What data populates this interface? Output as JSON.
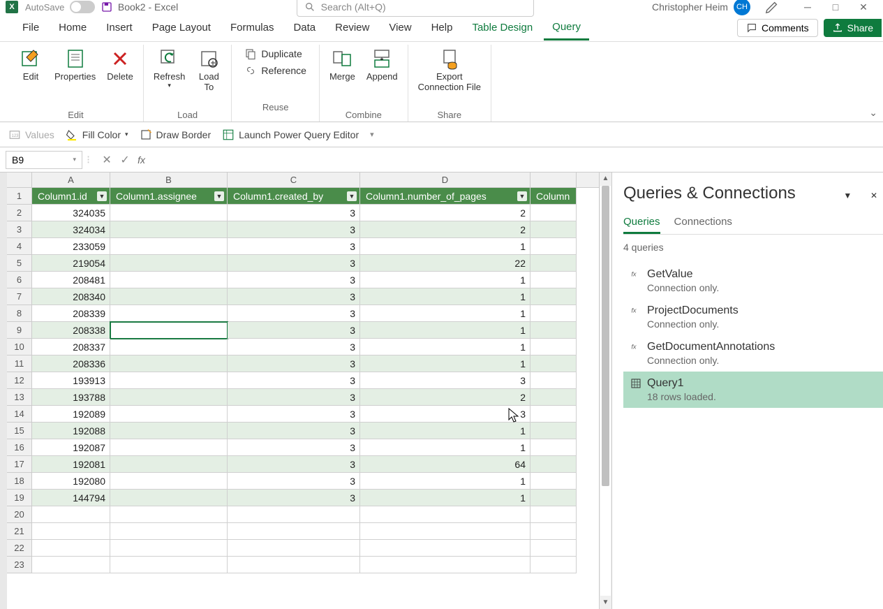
{
  "titlebar": {
    "autosave": "AutoSave",
    "autosave_state": "Off",
    "doc": "Book2  -  Excel",
    "search_placeholder": "Search (Alt+Q)",
    "user": "Christopher Heim",
    "initials": "CH"
  },
  "tabs": {
    "file": "File",
    "home": "Home",
    "insert": "Insert",
    "pagelayout": "Page Layout",
    "formulas": "Formulas",
    "data": "Data",
    "review": "Review",
    "view": "View",
    "help": "Help",
    "tabledesign": "Table Design",
    "query": "Query",
    "comments": "Comments",
    "share": "Share"
  },
  "ribbon": {
    "edit": "Edit",
    "properties": "Properties",
    "delete": "Delete",
    "refresh": "Refresh",
    "loadto": "Load\nTo",
    "duplicate": "Duplicate",
    "reference": "Reference",
    "merge": "Merge",
    "append": "Append",
    "export": "Export\nConnection File",
    "groups": {
      "edit": "Edit",
      "load": "Load",
      "reuse": "Reuse",
      "combine": "Combine",
      "share": "Share"
    }
  },
  "qtoolbar": {
    "values": "Values",
    "fillcolor": "Fill Color",
    "drawborder": "Draw Border",
    "launch": "Launch Power Query Editor"
  },
  "namebox": "B9",
  "columns": {
    "A": "A",
    "B": "B",
    "C": "C",
    "D": "D",
    "h1": "Column1.id",
    "h2": "Column1.assignee",
    "h3": "Column1.created_by",
    "h4": "Column1.number_of_pages",
    "h5": "Column"
  },
  "data_rows": [
    {
      "r": "1"
    },
    {
      "r": "2",
      "A": "324035",
      "C": "3",
      "D": "2"
    },
    {
      "r": "3",
      "A": "324034",
      "C": "3",
      "D": "2"
    },
    {
      "r": "4",
      "A": "233059",
      "C": "3",
      "D": "1"
    },
    {
      "r": "5",
      "A": "219054",
      "C": "3",
      "D": "22"
    },
    {
      "r": "6",
      "A": "208481",
      "C": "3",
      "D": "1"
    },
    {
      "r": "7",
      "A": "208340",
      "C": "3",
      "D": "1"
    },
    {
      "r": "8",
      "A": "208339",
      "C": "3",
      "D": "1"
    },
    {
      "r": "9",
      "A": "208338",
      "C": "3",
      "D": "1",
      "selB": true
    },
    {
      "r": "10",
      "A": "208337",
      "C": "3",
      "D": "1"
    },
    {
      "r": "11",
      "A": "208336",
      "C": "3",
      "D": "1"
    },
    {
      "r": "12",
      "A": "193913",
      "C": "3",
      "D": "3"
    },
    {
      "r": "13",
      "A": "193788",
      "C": "3",
      "D": "2"
    },
    {
      "r": "14",
      "A": "192089",
      "C": "3",
      "D": "3"
    },
    {
      "r": "15",
      "A": "192088",
      "C": "3",
      "D": "1"
    },
    {
      "r": "16",
      "A": "192087",
      "C": "3",
      "D": "1"
    },
    {
      "r": "17",
      "A": "192081",
      "C": "3",
      "D": "64"
    },
    {
      "r": "18",
      "A": "192080",
      "C": "3",
      "D": "1"
    },
    {
      "r": "19",
      "A": "144794",
      "C": "3",
      "D": "1"
    },
    {
      "r": "20"
    },
    {
      "r": "21"
    },
    {
      "r": "22"
    },
    {
      "r": "23"
    }
  ],
  "panel": {
    "title": "Queries & Connections",
    "tab_queries": "Queries",
    "tab_conn": "Connections",
    "count": "4 queries",
    "q1": "GetValue",
    "q1s": "Connection only.",
    "q2": "ProjectDocuments",
    "q2s": "Connection only.",
    "q3": "GetDocumentAnnotations",
    "q3s": "Connection only.",
    "q4": "Query1",
    "q4s": "18 rows loaded."
  }
}
